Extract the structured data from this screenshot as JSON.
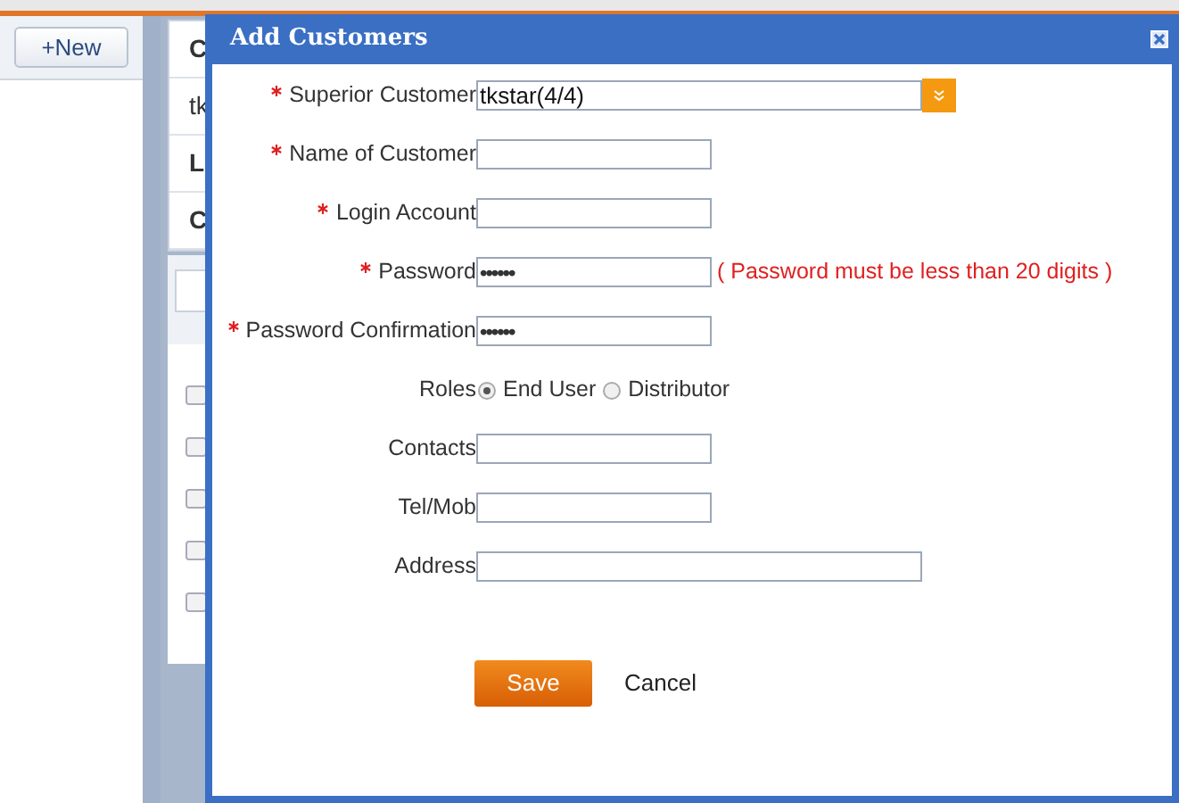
{
  "background": {
    "new_button": "+New",
    "panel_cells": [
      "C",
      "tk",
      "L",
      "C"
    ],
    "row_checkboxes": [
      {
        "checked": false
      },
      {
        "checked": false
      },
      {
        "checked": false
      },
      {
        "checked": false
      },
      {
        "checked": false
      }
    ]
  },
  "dialog": {
    "title": "Add Customers",
    "fields": [
      {
        "kind": "select",
        "label": "Superior Customer",
        "required": true,
        "value": "tkstar(4/4)"
      },
      {
        "kind": "text",
        "label": "Name of Customer",
        "required": true
      },
      {
        "kind": "text",
        "label": "Login Account",
        "required": true
      },
      {
        "kind": "password",
        "label": "Password",
        "required": true,
        "value": "••••••",
        "hint": "( Password must be less than 20 digits )"
      },
      {
        "kind": "password",
        "label": "Password Confirmation",
        "required": true,
        "value": "••••••"
      },
      {
        "kind": "radio",
        "label": "Roles",
        "options": [
          {
            "label": "End User",
            "selected": true
          },
          {
            "label": "Distributor",
            "selected": false
          }
        ]
      },
      {
        "kind": "text",
        "label": "Contacts",
        "required": false
      },
      {
        "kind": "text",
        "label": "Tel/Mob",
        "required": false
      },
      {
        "kind": "wide",
        "label": "Address",
        "required": false
      }
    ],
    "buttons": [
      {
        "kind": "primary",
        "label": "Save"
      },
      {
        "kind": "plain",
        "label": "Cancel"
      }
    ]
  }
}
